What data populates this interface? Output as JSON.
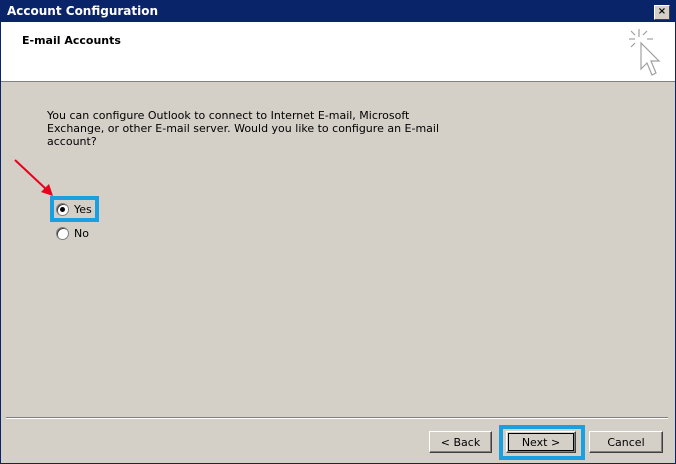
{
  "window": {
    "title": "Account Configuration",
    "close_label": "×"
  },
  "header": {
    "title": "E-mail Accounts",
    "icon": "cursor-sparkle-icon"
  },
  "content": {
    "question": "You can configure Outlook to connect to Internet E-mail, Microsoft Exchange, or other E-mail server. Would you like to configure an E-mail account?",
    "options": [
      {
        "label": "Yes",
        "selected": true
      },
      {
        "label": "No",
        "selected": false
      }
    ]
  },
  "buttons": {
    "back": "< Back",
    "next": "Next >",
    "cancel": "Cancel"
  },
  "colors": {
    "titlebar": "#0a246a",
    "highlight": "#1a9fe0",
    "arrow": "#e8001c",
    "dialog_bg": "#d4d0c8"
  }
}
